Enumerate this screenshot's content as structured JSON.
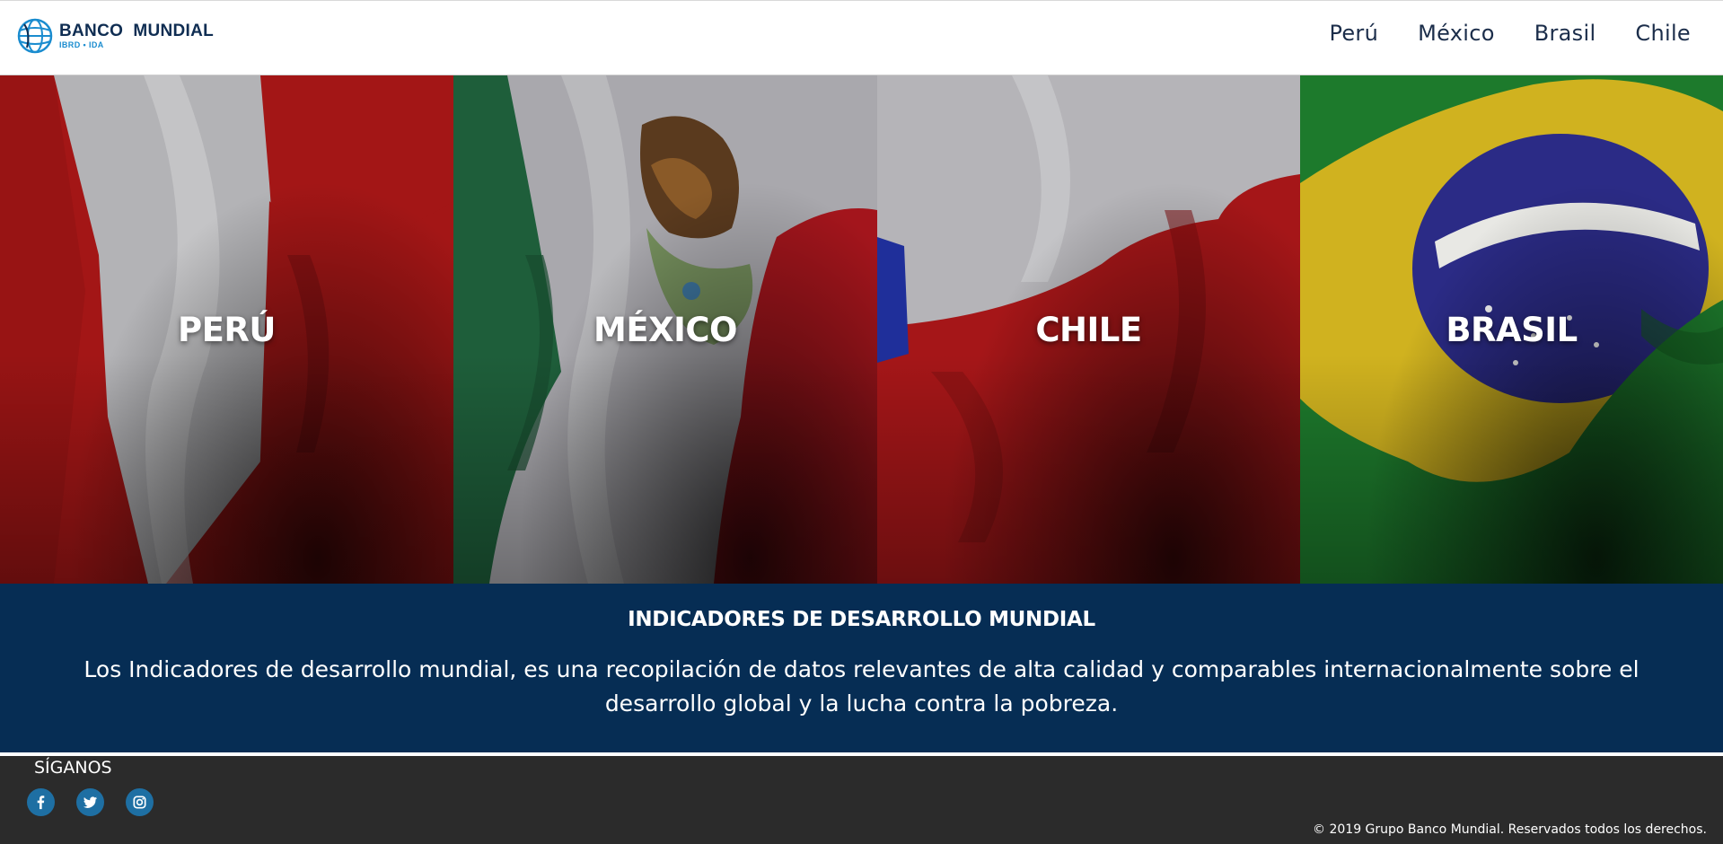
{
  "header": {
    "logo": {
      "name": "BANCO  MUNDIAL",
      "sub": "IBRD • IDA"
    },
    "nav": [
      {
        "label": "Perú"
      },
      {
        "label": "México"
      },
      {
        "label": "Brasil"
      },
      {
        "label": "Chile"
      }
    ]
  },
  "panels": [
    {
      "label": "PERÚ",
      "colors": [
        "#a31616",
        "#b3b3b6",
        "#a31616"
      ]
    },
    {
      "label": "MÉXICO",
      "colors": [
        "#1e5e3a",
        "#a9a8ad",
        "#a3151c"
      ]
    },
    {
      "label": "CHILE",
      "colors": [
        "#b5b4b8",
        "#a51618",
        "#1f2f9a"
      ]
    },
    {
      "label": "BRASIL",
      "colors": [
        "#1d7a2c",
        "#d0b21f",
        "#2b2b86"
      ]
    }
  ],
  "info": {
    "title": "INDICADORES DE DESARROLLO MUNDIAL",
    "text": "Los Indicadores de desarrollo mundial, es una recopilación de datos relevantes de alta calidad y comparables internacionalmente sobre el desarrollo global y la lucha contra la pobreza."
  },
  "footer": {
    "follow": "SÍGANOS",
    "socials": [
      "facebook-icon",
      "twitter-icon",
      "instagram-icon"
    ],
    "copyright": "© 2019 Grupo Banco Mundial. Reservados todos los derechos."
  },
  "colors": {
    "navy": "#062d54",
    "footer": "#2b2b2b",
    "social": "#1e6fa3",
    "logo_blue": "#1a8ccf"
  }
}
